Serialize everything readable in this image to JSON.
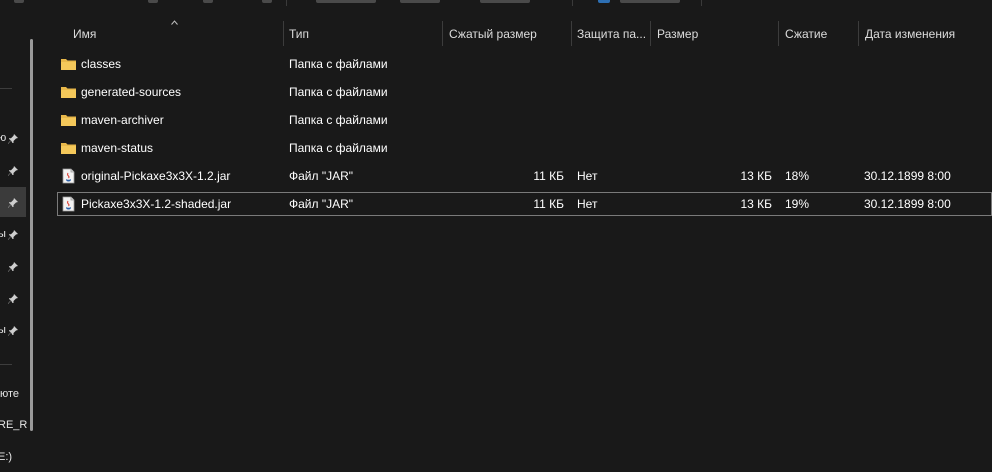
{
  "columns": {
    "name": "Имя",
    "type": "Тип",
    "compressed_size": "Сжатый размер",
    "protection": "Защита па...",
    "size": "Размер",
    "ratio": "Сжатие",
    "modified": "Дата изменения"
  },
  "nav": {
    "items": [
      "ю",
      "",
      "",
      "ы",
      "",
      "",
      "ы"
    ],
    "bottom": [
      "юте",
      "RE_R",
      "E:)"
    ]
  },
  "files": [
    {
      "name": "classes",
      "type": "Папка с файлами",
      "compressed_size": "",
      "protection": "",
      "size": "",
      "ratio": "",
      "modified": "",
      "icon": "folder-icon"
    },
    {
      "name": "generated-sources",
      "type": "Папка с файлами",
      "compressed_size": "",
      "protection": "",
      "size": "",
      "ratio": "",
      "modified": "",
      "icon": "folder-icon"
    },
    {
      "name": "maven-archiver",
      "type": "Папка с файлами",
      "compressed_size": "",
      "protection": "",
      "size": "",
      "ratio": "",
      "modified": "",
      "icon": "folder-icon"
    },
    {
      "name": "maven-status",
      "type": "Папка с файлами",
      "compressed_size": "",
      "protection": "",
      "size": "",
      "ratio": "",
      "modified": "",
      "icon": "folder-icon"
    },
    {
      "name": "original-Pickaxe3x3X-1.2.jar",
      "type": "Файл \"JAR\"",
      "compressed_size": "11 КБ",
      "protection": "Нет",
      "size": "13 КБ",
      "ratio": "18%",
      "modified": "30.12.1899 8:00",
      "icon": "jar-file-icon"
    },
    {
      "name": "Pickaxe3x3X-1.2-shaded.jar",
      "type": "Файл \"JAR\"",
      "compressed_size": "11 КБ",
      "protection": "Нет",
      "size": "13 КБ",
      "ratio": "19%",
      "modified": "30.12.1899 8:00",
      "icon": "jar-file-icon"
    }
  ],
  "colors": {
    "background": "#191919",
    "folder": "#e8b84a",
    "selection_border": "#7a7a7a"
  }
}
